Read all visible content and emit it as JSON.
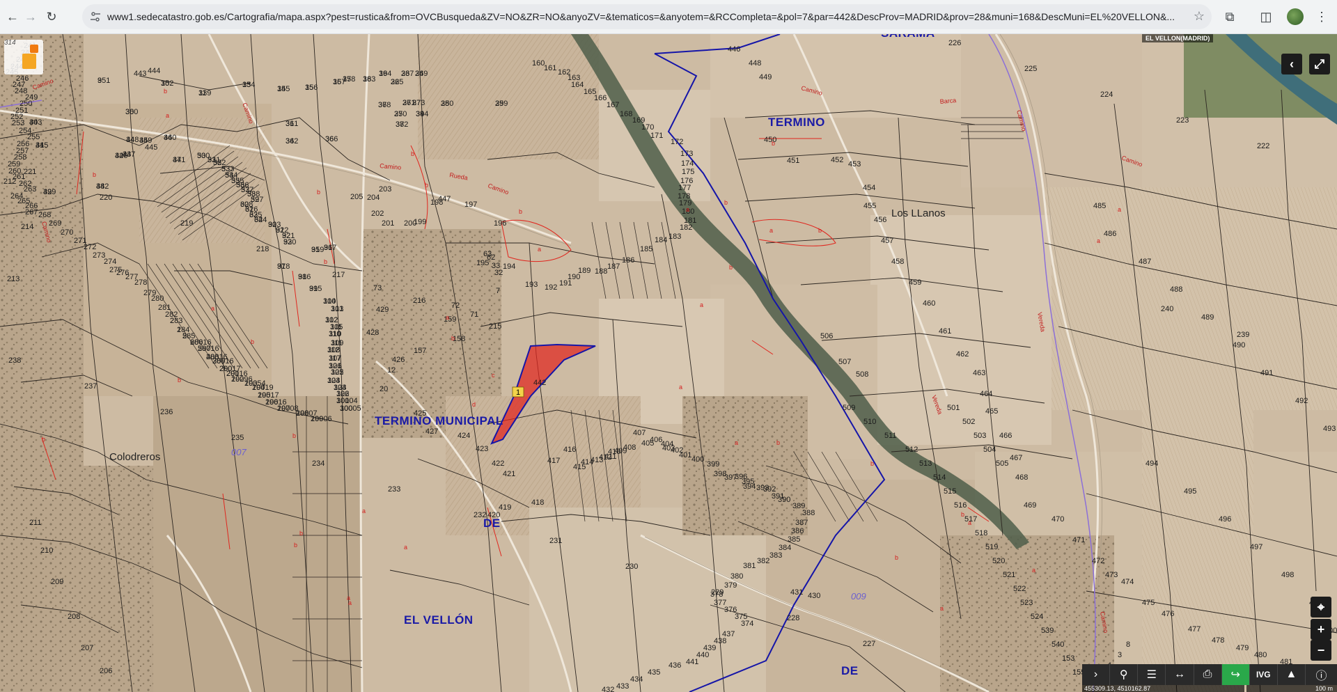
{
  "browser": {
    "url": "www1.sedecatastro.gob.es/Cartografia/mapa.aspx?pest=rustica&from=OVCBusqueda&ZV=NO&ZR=NO&anyoZV=&tematicos=&anyotem=&RCCompleta=&pol=7&par=442&DescProv=MADRID&prov=28&muni=168&DescMuni=EL%20VELLON&...",
    "icons": [
      "back-arrow-icon",
      "forward-arrow-icon",
      "reload-icon",
      "site-info-icon",
      "star-icon",
      "extensions-icon",
      "side-panel-icon",
      "profile-avatar",
      "menu-dots-icon"
    ]
  },
  "map": {
    "municipality_label": "EL VELLON(MADRID)",
    "sheet_label": "314",
    "selected_parcel": {
      "number": "442",
      "marker": "1",
      "fill": "#e0261e"
    },
    "area_labels": [
      {
        "id": "termino-municipal",
        "text": "TERMINO  MUNICIPAL"
      },
      {
        "id": "de-1",
        "text": "DE"
      },
      {
        "id": "el-vellon",
        "text": "EL VELLÓN"
      },
      {
        "id": "termino",
        "text": "TERMINO"
      },
      {
        "id": "de-2",
        "text": "DE"
      },
      {
        "id": "sarama",
        "text": "SARAMA"
      }
    ],
    "place_labels": [
      {
        "id": "colodreros",
        "text": "Colodreros"
      },
      {
        "id": "los-llanos",
        "text": "Los LLanos"
      }
    ],
    "polygon_labels": [
      {
        "id": "poly-007",
        "text": "007"
      },
      {
        "id": "poly-009",
        "text": "009"
      }
    ],
    "parcels": [
      "351",
      "352",
      "339",
      "354",
      "355",
      "356",
      "357",
      "358",
      "363",
      "364",
      "365",
      "367",
      "369",
      "370",
      "371",
      "373",
      "350",
      "359",
      "360",
      "361",
      "362",
      "366",
      "368",
      "372",
      "344",
      "343",
      "345",
      "346",
      "347",
      "348",
      "349",
      "340",
      "341",
      "342",
      "329",
      "330",
      "331",
      "332",
      "333",
      "334",
      "335",
      "336",
      "337",
      "338",
      "327",
      "328",
      "326",
      "325",
      "324",
      "323",
      "322",
      "321",
      "320",
      "319",
      "317",
      "318",
      "316",
      "315",
      "314",
      "313",
      "312",
      "311",
      "310",
      "309",
      "308",
      "307",
      "306",
      "305",
      "304",
      "303",
      "302",
      "301",
      "300",
      "299",
      "298",
      "297",
      "296",
      "295",
      "294",
      "293",
      "292",
      "291",
      "290",
      "289",
      "288",
      "287",
      "286",
      "285",
      "284",
      "283",
      "282",
      "281",
      "280",
      "279",
      "278",
      "277",
      "276",
      "275",
      "274",
      "273",
      "272",
      "271",
      "270",
      "269",
      "268",
      "267",
      "266",
      "265",
      "264",
      "263",
      "262",
      "261",
      "260",
      "259",
      "258",
      "257",
      "256",
      "255",
      "254",
      "253",
      "252",
      "251",
      "250",
      "249",
      "248",
      "247",
      "246",
      "245",
      "244",
      "243",
      "242",
      "241",
      "240",
      "239",
      "238",
      "237",
      "236",
      "235",
      "234",
      "233",
      "232",
      "231",
      "230",
      "229",
      "228",
      "227",
      "226",
      "225",
      "224",
      "223",
      "222",
      "221",
      "220",
      "219",
      "218",
      "217",
      "216",
      "215",
      "214",
      "213",
      "212",
      "211",
      "210",
      "209",
      "208",
      "207",
      "206",
      "205",
      "204",
      "203",
      "202",
      "201",
      "200",
      "199",
      "198",
      "197",
      "196",
      "195",
      "194",
      "193",
      "192",
      "191",
      "190",
      "189",
      "188",
      "187",
      "186",
      "185",
      "184",
      "183",
      "182",
      "181",
      "180",
      "179",
      "178",
      "177",
      "176",
      "175",
      "174",
      "173",
      "172",
      "171",
      "170",
      "169",
      "168",
      "167",
      "166",
      "165",
      "164",
      "163",
      "162",
      "161",
      "160",
      "159",
      "158",
      "157",
      "12",
      "20",
      "7",
      "32",
      "33",
      "62",
      "63",
      "71",
      "72",
      "73",
      "429",
      "428",
      "426",
      "425",
      "427",
      "424",
      "423",
      "422",
      "421",
      "420",
      "419",
      "418",
      "417",
      "416",
      "415",
      "414",
      "413",
      "412",
      "411",
      "410",
      "409",
      "408",
      "407",
      "406",
      "405",
      "404",
      "403",
      "402",
      "401",
      "400",
      "399",
      "398",
      "397",
      "396",
      "395",
      "394",
      "393",
      "392",
      "391",
      "390",
      "389",
      "388",
      "387",
      "386",
      "385",
      "384",
      "383",
      "382",
      "381",
      "380",
      "379",
      "378",
      "377",
      "376",
      "375",
      "374",
      "437",
      "438",
      "439",
      "440",
      "441",
      "436",
      "435",
      "434",
      "433",
      "432",
      "431",
      "430",
      "443",
      "444",
      "445",
      "446",
      "447",
      "448",
      "449",
      "450",
      "451",
      "452",
      "453",
      "454",
      "455",
      "456",
      "457",
      "458",
      "459",
      "460",
      "461",
      "462",
      "463",
      "464",
      "465",
      "466",
      "467",
      "468",
      "469",
      "470",
      "471",
      "472",
      "473",
      "474",
      "475",
      "476",
      "477",
      "478",
      "479",
      "480",
      "481",
      "482",
      "483",
      "484",
      "485",
      "486",
      "487",
      "488",
      "489",
      "490",
      "491",
      "492",
      "493",
      "494",
      "495",
      "496",
      "497",
      "498",
      "499",
      "500",
      "501",
      "502",
      "503",
      "504",
      "505",
      "506",
      "507",
      "508",
      "509",
      "510",
      "511",
      "512",
      "513",
      "514",
      "515",
      "516",
      "517",
      "518",
      "519",
      "520",
      "521",
      "522",
      "523",
      "524",
      "539",
      "540",
      "153",
      "155",
      "6",
      "4",
      "3",
      "8",
      "9",
      "10",
      "11",
      "13",
      "14",
      "15",
      "16",
      "17",
      "18",
      "19",
      "22",
      "23",
      "24",
      "25",
      "26",
      "27",
      "28",
      "29",
      "30",
      "31",
      "34",
      "36",
      "37",
      "38",
      "39",
      "40",
      "41",
      "42",
      "43",
      "44",
      "45",
      "46",
      "47",
      "48",
      "49",
      "50",
      "51",
      "52",
      "53",
      "54",
      "55",
      "56",
      "57",
      "58",
      "59",
      "60",
      "61",
      "63",
      "64",
      "90",
      "91",
      "92",
      "93",
      "95",
      "96",
      "97",
      "98",
      "99",
      "100",
      "101",
      "102",
      "105",
      "110",
      "111",
      "112",
      "117",
      "121",
      "122",
      "123",
      "124",
      "126",
      "10004",
      "10005",
      "10006",
      "10007",
      "10008",
      "10016",
      "10017",
      "10019",
      "10054",
      "10096",
      "20016",
      "20017",
      "30016",
      "40016",
      "50016",
      "60016",
      "5",
      "1",
      "2"
    ],
    "controls": {
      "collapse": "‹",
      "fullscreen": "⤢",
      "locate": "⌖",
      "zoom_in": "+",
      "zoom_out": "−",
      "toolbar": [
        "›",
        "search",
        "layers",
        "measure",
        "print",
        "route",
        "IVG",
        "3d",
        "info"
      ]
    },
    "coordinates": "455309.13, 4510162.87",
    "scale": "100 m"
  }
}
